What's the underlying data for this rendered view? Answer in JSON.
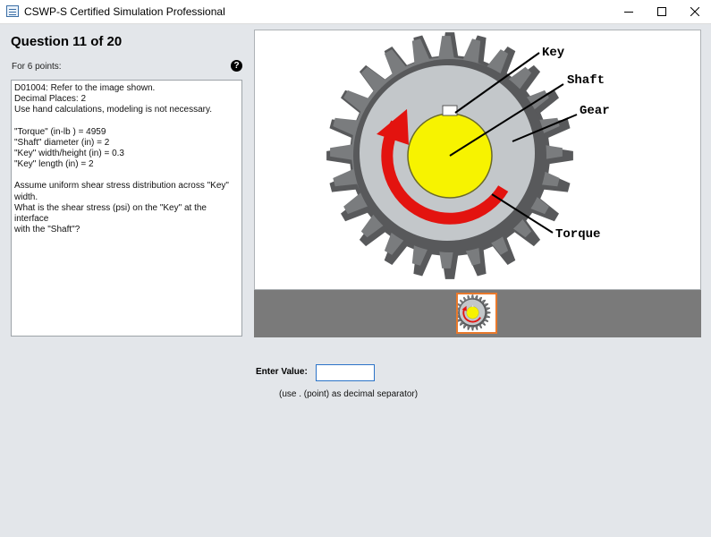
{
  "window": {
    "title": "CSWP-S Certified Simulation Professional",
    "controls": [
      "minimize-icon",
      "maximize-icon",
      "close-icon"
    ]
  },
  "question": {
    "header": "Question 11 of 20",
    "points": "For 6 points:",
    "lines": [
      "D01004:  Refer to the image shown.",
      "Decimal Places: 2",
      "Use hand calculations, modeling is not necessary.",
      "",
      "\"Torque\" (in-lb ) =  4959",
      "\"Shaft\" diameter (in) =  2",
      "\"Key\" width/height (in) = 0.3",
      "\"Key\" length (in) = 2",
      "",
      "Assume uniform shear stress distribution across \"Key\"",
      "width.",
      "What is the shear stress (psi) on the \"Key\" at the interface",
      "with the \"Shaft\"?"
    ]
  },
  "figure": {
    "labels": {
      "key": "Key",
      "shaft": "Shaft",
      "gear": "Gear",
      "torque": "Torque"
    },
    "colors": {
      "gear_dark": "#58595b",
      "gear_light": "#c3c7ca",
      "shaft": "#f7f300",
      "arrow": "#e3130f",
      "thumb_border": "#e8792c"
    }
  },
  "answer": {
    "label": "Enter Value:",
    "value": "",
    "hint": "(use . (point) as decimal separator)"
  }
}
